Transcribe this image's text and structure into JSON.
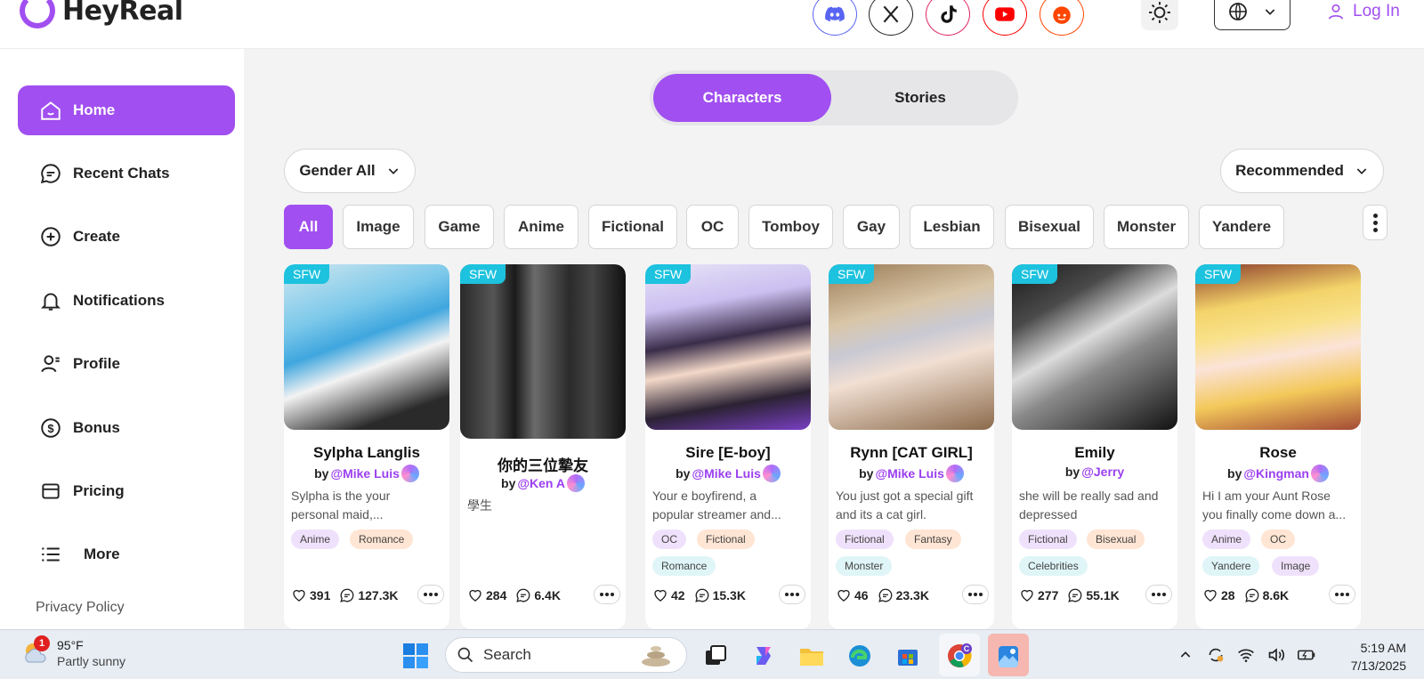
{
  "app": {
    "name": "HeyReal",
    "login_label": "Log In"
  },
  "social_icons": [
    "discord-icon",
    "x-icon",
    "tiktok-icon",
    "youtube-icon",
    "reddit-icon"
  ],
  "sidebar": {
    "items": [
      {
        "label": "Home",
        "icon": "home-icon",
        "active": true
      },
      {
        "label": "Recent Chats",
        "icon": "chat-icon"
      },
      {
        "label": "Create",
        "icon": "plus-circle-icon"
      },
      {
        "label": "Notifications",
        "icon": "bell-icon"
      },
      {
        "label": "Profile",
        "icon": "user-icon"
      },
      {
        "label": "Bonus",
        "icon": "dollar-icon"
      },
      {
        "label": "Pricing",
        "icon": "card-icon"
      },
      {
        "label": "More",
        "icon": "list-icon"
      }
    ],
    "privacy": "Privacy Policy"
  },
  "tabs": {
    "characters": "Characters",
    "stories": "Stories"
  },
  "filters": {
    "gender": "Gender All",
    "sort": "Recommended"
  },
  "categories": [
    "All",
    "Image",
    "Game",
    "Anime",
    "Fictional",
    "OC",
    "Tomboy",
    "Gay",
    "Lesbian",
    "Bisexual",
    "Monster",
    "Yandere"
  ],
  "cards": [
    {
      "badge": "SFW",
      "name": "Sylpha Langlis",
      "by": "by",
      "author": "@Mike Luis",
      "desc1": "Sylpha is the your",
      "desc2": "personal maid,...",
      "tags": [
        "Anime",
        "Romance"
      ],
      "likes": "391",
      "chats": "127.3K"
    },
    {
      "badge": "SFW",
      "name": "你的三位摯友",
      "by": "by",
      "author": "@Ken A",
      "desc1": "學生",
      "desc2": "",
      "tags": [],
      "likes": "284",
      "chats": "6.4K"
    },
    {
      "badge": "SFW",
      "name": "Sire [E-boy]",
      "by": "by",
      "author": "@Mike Luis",
      "desc1": "Your e boyfirend, a",
      "desc2": "popular streamer and...",
      "tags": [
        "OC",
        "Fictional",
        "Romance"
      ],
      "likes": "42",
      "chats": "15.3K"
    },
    {
      "badge": "SFW",
      "name": "Rynn [CAT GIRL]",
      "by": "by",
      "author": "@Mike Luis",
      "desc1": "You just got a special gift",
      "desc2": "and its a cat girl.",
      "tags": [
        "Fictional",
        "Fantasy",
        "Monster"
      ],
      "likes": "46",
      "chats": "23.3K"
    },
    {
      "badge": "SFW",
      "name": "Emily",
      "by": "by",
      "author": "@Jerry",
      "desc1": "she will be really sad and",
      "desc2": "depressed",
      "tags": [
        "Fictional",
        "Bisexual",
        "Celebrities"
      ],
      "likes": "277",
      "chats": "55.1K"
    },
    {
      "badge": "SFW",
      "name": "Rose",
      "by": "by",
      "author": "@Kingman",
      "desc1": "Hi I am your Aunt Rose",
      "desc2": "you finally come down a...",
      "tags": [
        "Anime",
        "OC",
        "Yandere",
        "Image"
      ],
      "likes": "28",
      "chats": "8.6K"
    }
  ],
  "taskbar": {
    "weather_temp": "95°F",
    "weather_cond": "Partly sunny",
    "notification_count": "1",
    "search_placeholder": "Search",
    "time": "5:19 AM",
    "date": "7/13/2025"
  },
  "colors": {
    "accent": "#a14ff0",
    "sfw": "#1cc2de"
  }
}
